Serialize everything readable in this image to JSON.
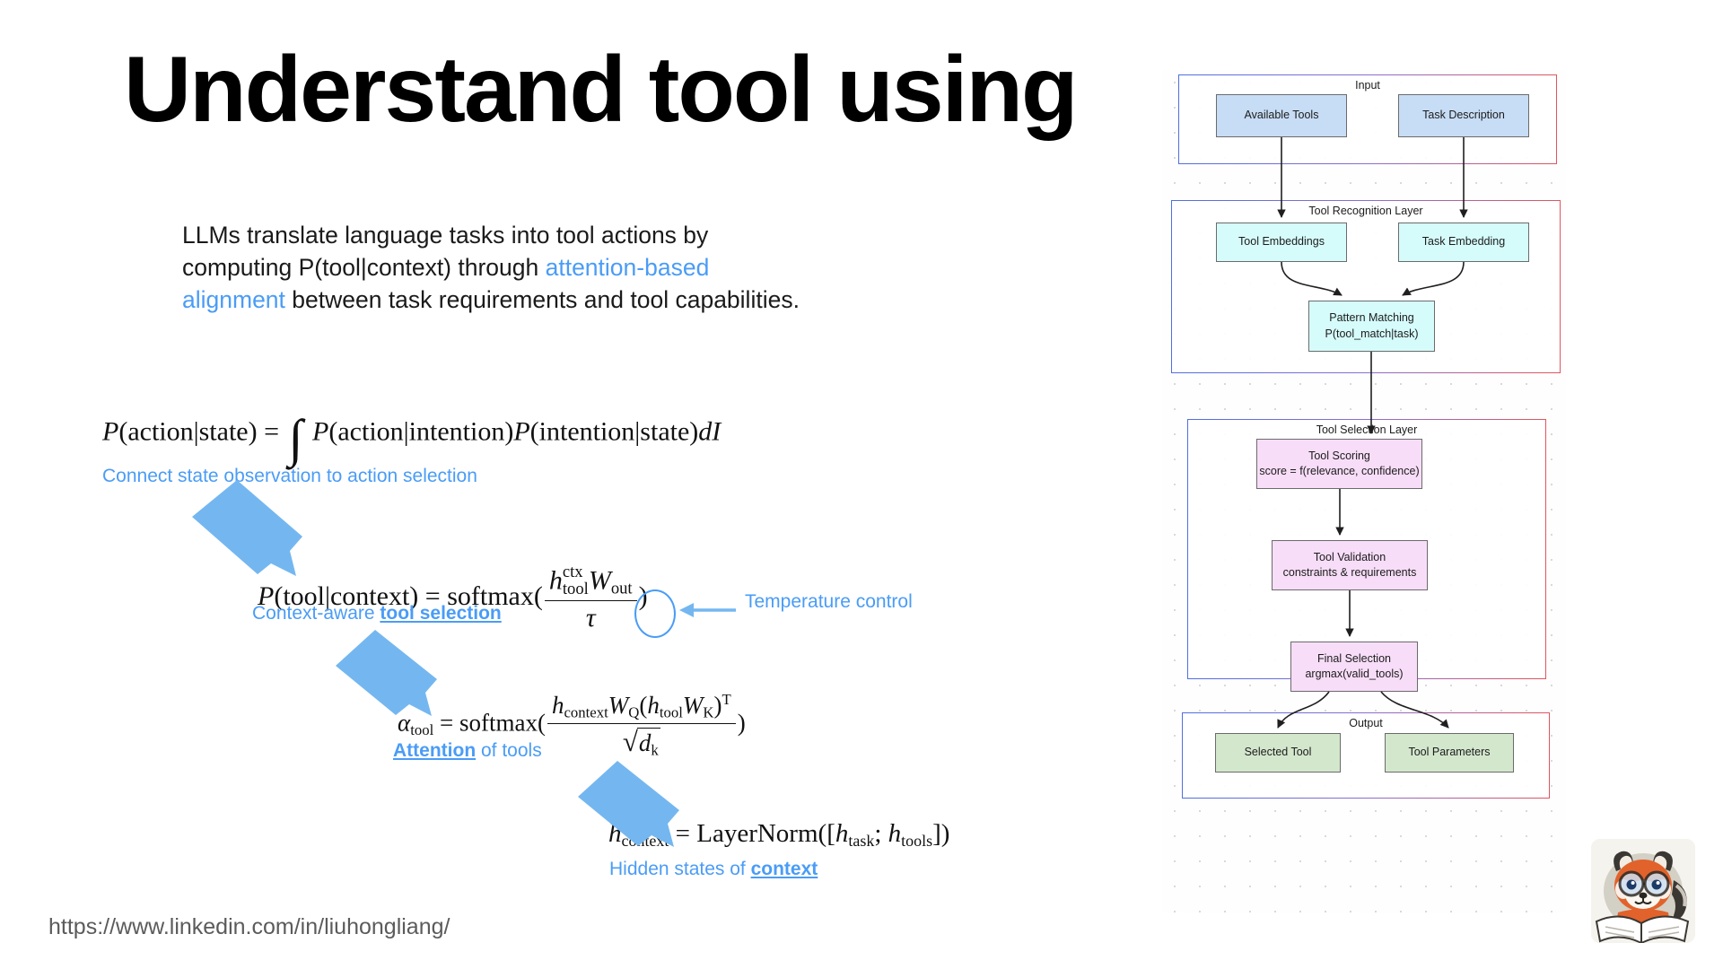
{
  "slide": {
    "title": "Understand tool using",
    "footer_url": "https://www.linkedin.com/in/liuhongliang/"
  },
  "intro": {
    "seg1": "LLMs translate language tasks into tool actions by computing P(tool|context) through ",
    "highlight": "attention-based alignment",
    "seg2": " between task requirements and tool capabilities."
  },
  "formulas": [
    {
      "id": "formula-1",
      "latex": "P(action|state) = \\int P(action|intention)P(intention|state)dI",
      "plain": "P(action|state) = ∫ P(action|intention)P(intention|state)dI",
      "parts": {
        "lhs_P": "P",
        "lhs_args": "(action|state)",
        "eq": "=",
        "integral": "∫",
        "t1_P": "P",
        "t1_args": "(action|intention)",
        "t2_P": "P",
        "t2_args": "(intention|state)",
        "diff_d": "d",
        "diff_var": "I"
      },
      "annotation": "Connect state observation to action selection",
      "annotation_bold": ""
    },
    {
      "id": "formula-2",
      "latex": "P(tool|context) = softmax(\\frac{h^{ctx}_{tool}W_{out}}{\\tau})",
      "plain": "P(tool|context) = softmax( (h_tool^ctx W_out) / τ )",
      "parts": {
        "lhs_P": "P",
        "lhs_args": "(tool|context)",
        "eq": "=",
        "fn": "softmax",
        "h": "h",
        "h_sup": "ctx",
        "h_sub": "tool",
        "W": "W",
        "W_sub": "out",
        "den": "τ"
      },
      "annotation_prefix": "Context-aware ",
      "annotation_bold": "tool selection",
      "callout": "Temperature control"
    },
    {
      "id": "formula-3",
      "latex": "\\alpha_{tool} = softmax(\\frac{h_{context}W_Q(h_{tool}W_K)^T}{\\sqrt{d_k}})",
      "plain": "α_tool = softmax( (h_context W_Q (h_tool W_K)^T) / sqrt(d_k) )",
      "parts": {
        "alpha": "α",
        "alpha_sub": "tool",
        "eq": "=",
        "fn": "softmax",
        "h1": "h",
        "h1_sub": "context",
        "WQ": "W",
        "WQ_sub": "Q",
        "h2": "h",
        "h2_sub": "tool",
        "WK": "W",
        "WK_sub": "K",
        "transpose": "T",
        "radical": "√",
        "d": "d",
        "d_sub": "k"
      },
      "annotation_bold": "Attention",
      "annotation_suffix": " of tools"
    },
    {
      "id": "formula-4",
      "latex": "h_{context} = LayerNorm([h_{task}; h_{tools}])",
      "plain": "h_context = LayerNorm([h_task; h_tools])",
      "parts": {
        "h": "h",
        "h_sub": "context",
        "eq": "=",
        "fn": "LayerNorm",
        "open": "([",
        "h1": "h",
        "h1_sub": "task",
        "semi": "; ",
        "h2": "h",
        "h2_sub": "tools",
        "close": "])"
      },
      "annotation_prefix": "Hidden states of ",
      "annotation_bold": "context"
    }
  ],
  "diagram": {
    "groups": [
      {
        "label": "Input",
        "nodes": [
          {
            "label": "Available Tools",
            "color": "#c7dcf5"
          },
          {
            "label": "Task Description",
            "color": "#c7dcf5"
          }
        ]
      },
      {
        "label": "Tool Recognition Layer",
        "nodes": [
          {
            "label": "Tool Embeddings",
            "color": "#d6fbfb"
          },
          {
            "label": "Task Embedding",
            "color": "#d6fbfb"
          },
          {
            "label": "Pattern Matching",
            "sublabel": "P(tool_match|task)",
            "color": "#d6fbfb"
          }
        ]
      },
      {
        "label": "Tool Selection Layer",
        "nodes": [
          {
            "label": "Tool Scoring",
            "sublabel": "score = f(relevance, confidence)",
            "color": "#f7ddf7"
          },
          {
            "label": "Tool Validation",
            "sublabel": "constraints & requirements",
            "color": "#f7ddf7"
          },
          {
            "label": "Final Selection",
            "sublabel": "argmax(valid_tools)",
            "color": "#f7ddf7"
          }
        ]
      },
      {
        "label": "Output",
        "nodes": [
          {
            "label": "Selected Tool",
            "color": "#d3e7cd"
          },
          {
            "label": "Tool Parameters",
            "color": "#d3e7cd"
          }
        ]
      }
    ]
  },
  "colors": {
    "accent_blue": "#4a9cf6",
    "group_border_start": "#4f6fe0",
    "group_border_end": "#e0555f",
    "node_blue": "#c7dcf5",
    "node_cyan": "#d6fbfb",
    "node_pink": "#f7ddf7",
    "node_green": "#d3e7cd",
    "footer_gray": "#5b5b5b"
  },
  "avatar": {
    "name": "red-panda-reading-avatar"
  }
}
